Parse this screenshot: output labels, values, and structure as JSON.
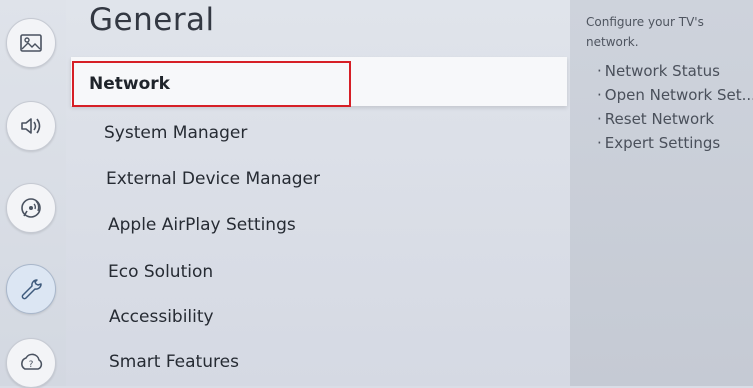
{
  "panel": {
    "title": "General",
    "items": [
      {
        "label": "Network"
      },
      {
        "label": "System Manager"
      },
      {
        "label": "External Device Manager"
      },
      {
        "label": "Apple AirPlay Settings"
      },
      {
        "label": "Eco Solution"
      },
      {
        "label": "Accessibility"
      },
      {
        "label": "Smart Features"
      }
    ]
  },
  "sidebar": {
    "categories": [
      {
        "icon": "picture-icon"
      },
      {
        "icon": "sound-icon"
      },
      {
        "icon": "broadcasting-icon"
      },
      {
        "icon": "wrench-icon",
        "active": true
      },
      {
        "icon": "support-icon"
      }
    ]
  },
  "info": {
    "description": "Configure your TV's network.",
    "options": [
      "Network Status",
      "Open Network Set...",
      "Reset Network",
      "Expert Settings"
    ]
  },
  "colors": {
    "focus_border": "#d61f26"
  }
}
